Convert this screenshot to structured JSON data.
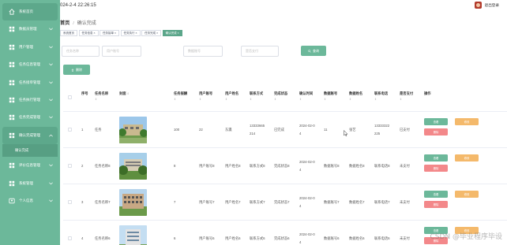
{
  "sidebar": {
    "items": [
      {
        "label": "系统首页",
        "icon": "home-icon",
        "home": true
      },
      {
        "label": "数据员管理",
        "icon": "grid-icon"
      },
      {
        "label": "用户管理",
        "icon": "grid-icon"
      },
      {
        "label": "任务信息管理",
        "icon": "grid-icon"
      },
      {
        "label": "任务接单管理",
        "icon": "grid-icon"
      },
      {
        "label": "任务执行管理",
        "icon": "grid-icon"
      },
      {
        "label": "任务完成管理",
        "icon": "grid-icon"
      },
      {
        "label": "确认完成管理",
        "icon": "grid-icon",
        "active": true
      }
    ],
    "submenu": {
      "label": "确认完成"
    },
    "items_after": [
      {
        "label": "评价信息管理",
        "icon": "grid-icon"
      },
      {
        "label": "系统管理",
        "icon": "grid-icon"
      },
      {
        "label": "个人信息",
        "icon": "person-icon"
      }
    ]
  },
  "topbar": {
    "datetime": "024-2-4 22:26:15",
    "logout": "退出登录"
  },
  "breadcrumb": {
    "home": "首页",
    "separator": "/",
    "current": "确认完成"
  },
  "tags": [
    {
      "label": "系统首页"
    },
    {
      "label": "任务信息 ×"
    },
    {
      "label": "任务接单 ×"
    },
    {
      "label": "任务执行 ×"
    },
    {
      "label": "任务完成 ×"
    },
    {
      "label": "确认完成 ×",
      "active": true
    }
  ],
  "search": {
    "fields": [
      {
        "placeholder": "任务名称"
      },
      {
        "placeholder": "用户账号"
      },
      {
        "placeholder": "数据账号"
      },
      {
        "placeholder": "是否支付"
      }
    ],
    "button": "查询"
  },
  "delete_button": "删除",
  "table": {
    "columns": [
      "序号",
      "任务名称",
      "封面",
      "任务报酬",
      "用户账号",
      "用户姓名",
      "联系方式",
      "完成状态",
      "确认时间",
      "数据账号",
      "数据姓名",
      "联系电话",
      "是否支付",
      "操作"
    ],
    "sort_glyph": "⇕",
    "rows": [
      {
        "idx": "1",
        "name": "任务",
        "pay": "100",
        "user": "22",
        "uname": "东瀛",
        "phone_l1": "13333665",
        "phone_l2": "214",
        "status": "已完成",
        "time_l1": "2024-02-0",
        "time_l2": "4",
        "dacc": "11",
        "dname": "张艺",
        "dphone_l1": "13333322",
        "dphone_l2": "225",
        "paid": "已支付"
      },
      {
        "idx": "2",
        "name": "任务名称8",
        "pay": "8",
        "user": "用户账号8",
        "uname": "用户姓名8",
        "phone_l1": "联系方式8",
        "phone_l2": "",
        "status": "完成状态8",
        "time_l1": "2024-02-0",
        "time_l2": "4",
        "dacc": "数据账号8",
        "dname": "数据姓名8",
        "dphone_l1": "联系电话8",
        "dphone_l2": "",
        "paid": "未支付"
      },
      {
        "idx": "3",
        "name": "任务名称7",
        "pay": "7",
        "user": "用户账号7",
        "uname": "用户姓名7",
        "phone_l1": "联系方式7",
        "phone_l2": "",
        "status": "完成状态7",
        "time_l1": "2024-02-0",
        "time_l2": "4",
        "dacc": "数据账号7",
        "dname": "数据姓名7",
        "dphone_l1": "联系电话7",
        "dphone_l2": "",
        "paid": "未支付"
      },
      {
        "idx": "4",
        "name": "任务名称6",
        "pay": "6",
        "user": "用户账号6",
        "uname": "用户姓名6",
        "phone_l1": "联系方式6",
        "phone_l2": "",
        "status": "完成状态6",
        "time_l1": "2024-02-0",
        "time_l2": "4",
        "dacc": "数据账号6",
        "dname": "数据姓名6",
        "dphone_l1": "联系电话6",
        "dphone_l2": "",
        "paid": "未支付"
      }
    ],
    "actions": {
      "view": "查看",
      "edit": "修改",
      "delete": "删除"
    }
  },
  "watermark": "CSDN @毕业程序毕设",
  "colors": {
    "accent": "#6cb89a",
    "edit": "#f4b96b",
    "delete": "#f3888a"
  }
}
